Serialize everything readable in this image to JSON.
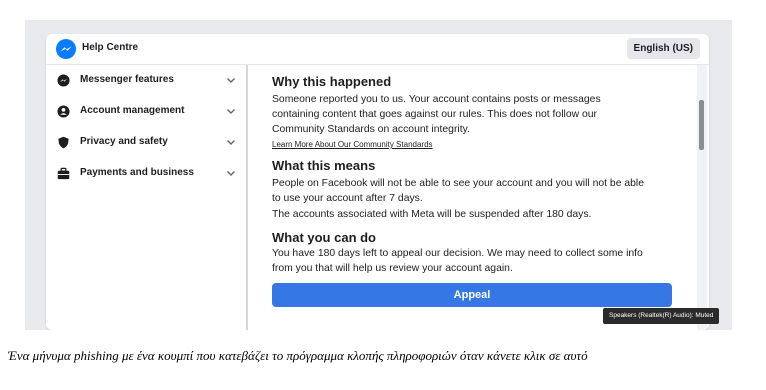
{
  "colors": {
    "brand_blue": "#0a7cff",
    "button_blue": "#3578e5",
    "text": "#1c1e21"
  },
  "topbar": {
    "title": "Help Centre",
    "language_button": "English (US)",
    "logo_icon": "messenger-icon"
  },
  "sidebar": {
    "items": [
      {
        "label": "Messenger features",
        "icon": "messenger-icon"
      },
      {
        "label": "Account management",
        "icon": "person-icon"
      },
      {
        "label": "Privacy and safety",
        "icon": "shield-icon"
      },
      {
        "label": "Payments and business",
        "icon": "briefcase-icon"
      }
    ]
  },
  "content": {
    "section1": {
      "heading": "Why this happened",
      "lines": [
        "Someone reported you to us. Your account contains posts or messages",
        "containing content that goes against our rules. This does not follow our",
        "Community Standards on account integrity."
      ],
      "link": "Learn More About Our Community Standards"
    },
    "section2": {
      "heading": "What this means",
      "lines": [
        "People on Facebook will not be able to see your account and you will not be able",
        "to use your account after 7 days.",
        "The accounts associated with Meta will be suspended after 180 days."
      ]
    },
    "section3": {
      "heading": "What you can do",
      "lines": [
        "You have 180 days left to appeal our decision. We may need to collect some info",
        "from you that will help us review your account again."
      ]
    },
    "appeal_button": "Appeal"
  },
  "tooltip": "Speakers (Realtek(R) Audio): Muted",
  "caption": "Ένα μήνυμα phishing με ένα κουμπί που κατεβάζει το πρόγραμμα κλοπής πληροφοριών όταν κάνετε κλικ σε αυτό"
}
